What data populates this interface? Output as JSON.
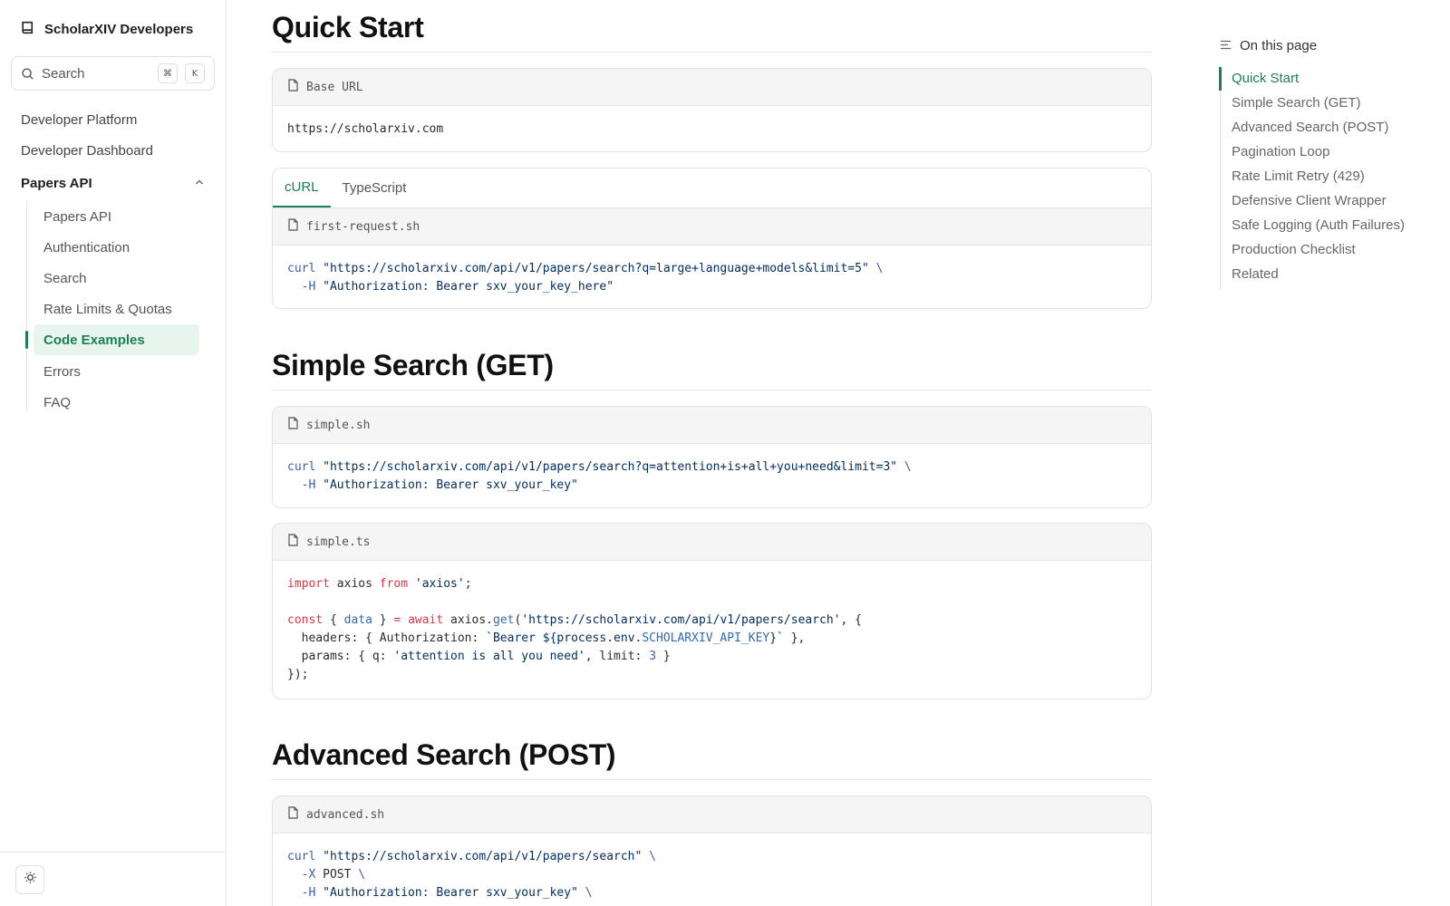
{
  "sidebar": {
    "brand": "ScholarXIV Developers",
    "search": {
      "label": "Search",
      "shortcut_mod": "⌘",
      "shortcut_key": "K"
    },
    "top_links": [
      "Developer Platform",
      "Developer Dashboard"
    ],
    "section": {
      "label": "Papers API",
      "expanded": true
    },
    "sub_items": [
      {
        "label": "Papers API",
        "active": false
      },
      {
        "label": "Authentication",
        "active": false
      },
      {
        "label": "Search",
        "active": false
      },
      {
        "label": "Rate Limits & Quotas",
        "active": false
      },
      {
        "label": "Code Examples",
        "active": true
      },
      {
        "label": "Errors",
        "active": false
      },
      {
        "label": "FAQ",
        "active": false
      }
    ]
  },
  "main": {
    "sections": [
      {
        "title": "Quick Start"
      },
      {
        "title": "Simple Search (GET)"
      },
      {
        "title": "Advanced Search (POST)"
      }
    ],
    "base_url": {
      "filename": "Base URL",
      "code": "https://scholarxiv.com"
    },
    "quick_tabs": [
      "cURL",
      "TypeScript"
    ],
    "first_request": {
      "filename": "first-request.sh",
      "lines": [
        [
          [
            "cmd",
            "curl"
          ],
          [
            "str",
            " \"https://scholarxiv.com/api/v1/papers/search?q=large+language+models&limit=5\""
          ],
          [
            "cmd",
            " \\"
          ]
        ],
        [
          [
            "cmd",
            "  -H"
          ],
          [
            "str",
            " \"Authorization: Bearer sxv_your_key_here\""
          ]
        ]
      ]
    },
    "simple_sh": {
      "filename": "simple.sh",
      "lines": [
        [
          [
            "cmd",
            "curl"
          ],
          [
            "str",
            " \"https://scholarxiv.com/api/v1/papers/search?q=attention+is+all+you+need&limit=3\""
          ],
          [
            "cmd",
            " \\"
          ]
        ],
        [
          [
            "cmd",
            "  -H"
          ],
          [
            "str",
            " \"Authorization: Bearer sxv_your_key\""
          ]
        ]
      ]
    },
    "simple_ts": {
      "filename": "simple.ts",
      "lines": [
        [
          [
            "kw",
            "import"
          ],
          [
            "",
            " axios "
          ],
          [
            "kw",
            "from"
          ],
          [
            "str",
            " 'axios'"
          ],
          [
            "",
            ";"
          ]
        ],
        [],
        [
          [
            "kw",
            "const"
          ],
          [
            "",
            " { "
          ],
          [
            "var",
            "data"
          ],
          [
            "",
            " } "
          ],
          [
            "kw",
            "="
          ],
          [
            "kw",
            " await"
          ],
          [
            "",
            " axios."
          ],
          [
            "var",
            "get"
          ],
          [
            "",
            "("
          ],
          [
            "str",
            "'https://scholarxiv.com/api/v1/papers/search'"
          ],
          [
            "",
            ", {"
          ]
        ],
        [
          [
            "",
            "  headers: { Authorization: "
          ],
          [
            "str",
            "`Bearer ${process.env."
          ],
          [
            "var",
            "SCHOLARXIV_API_KEY"
          ],
          [
            "str",
            "}`"
          ],
          [
            "",
            " },"
          ]
        ],
        [
          [
            "",
            "  params: { q: "
          ],
          [
            "str",
            "'attention is all you need'"
          ],
          [
            "",
            ", limit: "
          ],
          [
            "num",
            "3"
          ],
          [
            "",
            " }"
          ]
        ],
        [
          [
            "",
            "});"
          ]
        ]
      ]
    },
    "advanced_sh": {
      "filename": "advanced.sh",
      "lines": [
        [
          [
            "cmd",
            "curl"
          ],
          [
            "str",
            " \"https://scholarxiv.com/api/v1/papers/search\""
          ],
          [
            "cmd",
            " \\"
          ]
        ],
        [
          [
            "cmd",
            "  -X"
          ],
          [
            "",
            " POST"
          ],
          [
            "cmd",
            " \\"
          ]
        ],
        [
          [
            "cmd",
            "  -H"
          ],
          [
            "str",
            " \"Authorization: Bearer sxv_your_key\""
          ],
          [
            "cmd",
            " \\"
          ]
        ]
      ]
    }
  },
  "toc": {
    "title": "On this page",
    "items": [
      {
        "label": "Quick Start",
        "active": true
      },
      {
        "label": "Simple Search (GET)",
        "active": false
      },
      {
        "label": "Advanced Search (POST)",
        "active": false
      },
      {
        "label": "Pagination Loop",
        "active": false
      },
      {
        "label": "Rate Limit Retry (429)",
        "active": false
      },
      {
        "label": "Defensive Client Wrapper",
        "active": false
      },
      {
        "label": "Safe Logging (Auth Failures)",
        "active": false
      },
      {
        "label": "Production Checklist",
        "active": false
      },
      {
        "label": "Related",
        "active": false
      }
    ]
  },
  "colors": {
    "accent": "#1b7f5a",
    "keyword": "#d73a49",
    "command": "#3b5bab"
  },
  "icons": [
    "book-icon",
    "search-icon",
    "chevron-up-icon",
    "file-icon",
    "menu-lines-icon",
    "sun-icon"
  ]
}
